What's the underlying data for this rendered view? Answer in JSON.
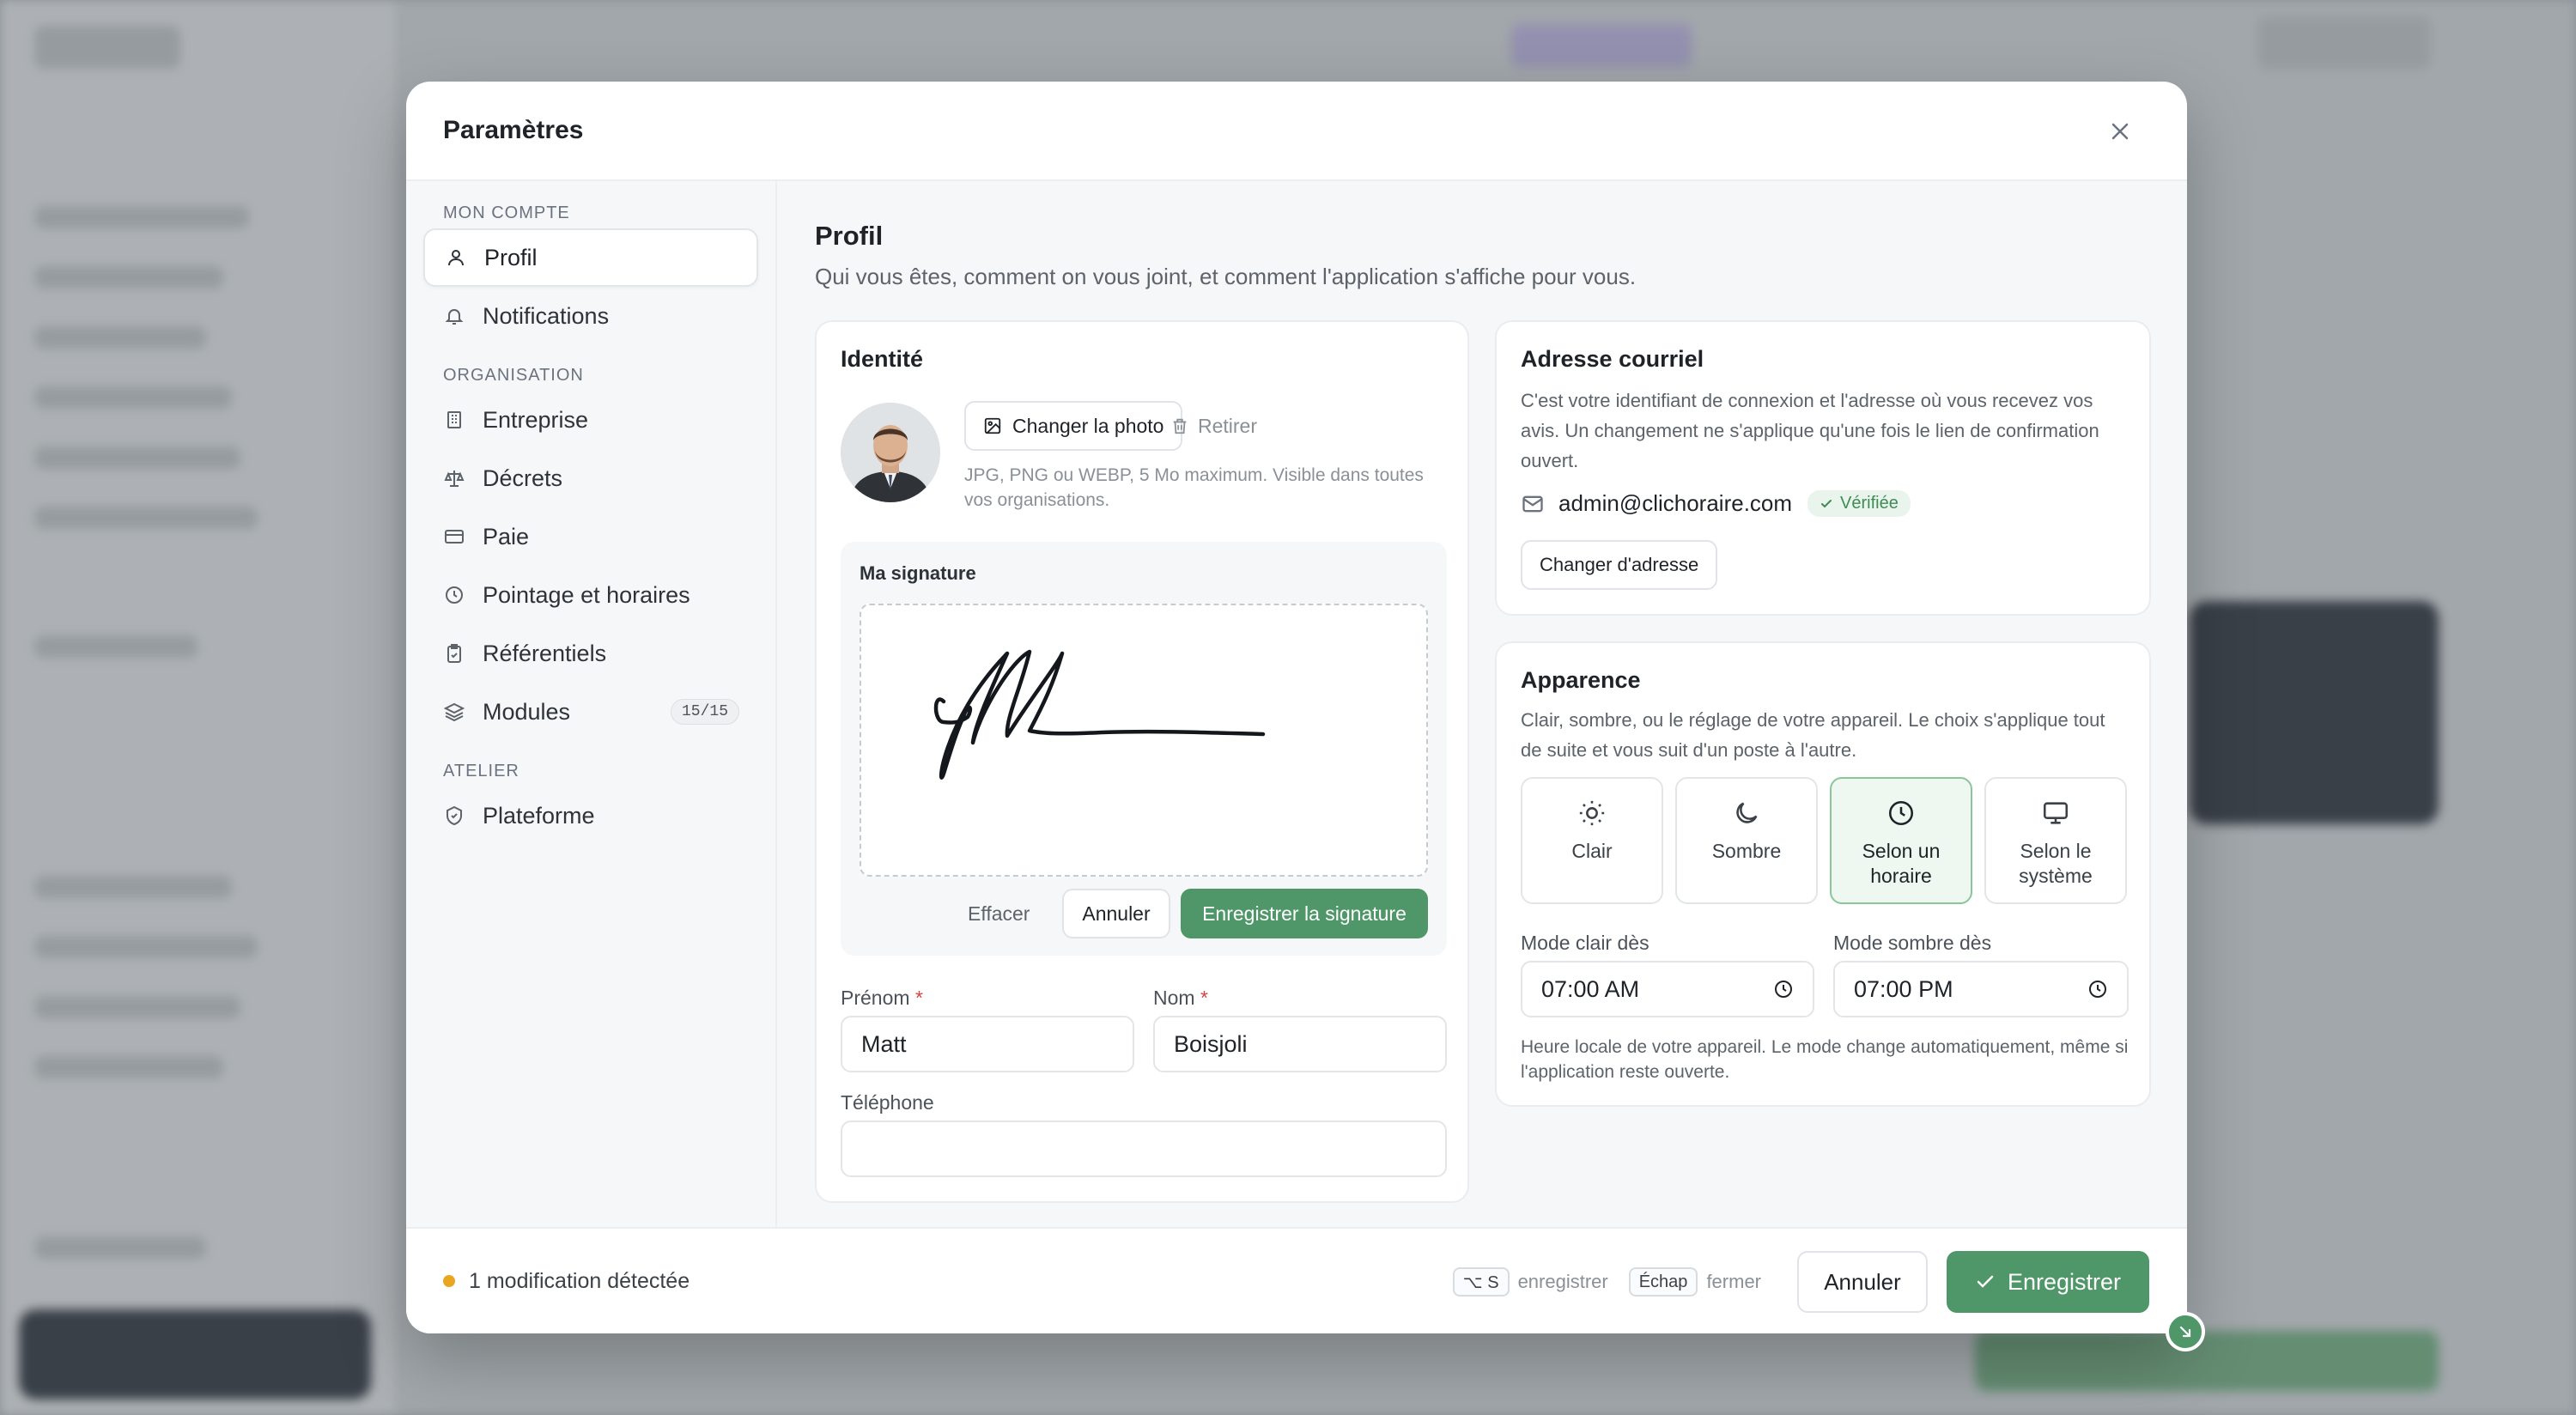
{
  "modal": {
    "title": "Paramètres"
  },
  "nav": {
    "sections": {
      "account": "MON COMPTE",
      "organization": "ORGANISATION",
      "workshop": "ATELIER"
    },
    "items": {
      "profile": "Profil",
      "notifications": "Notifications",
      "company": "Entreprise",
      "decrees": "Décrets",
      "payroll": "Paie",
      "timekeeping": "Pointage et horaires",
      "references": "Référentiels",
      "modules": "Modules",
      "modules_badge": "15/15",
      "platform": "Plateforme"
    }
  },
  "content": {
    "title": "Profil",
    "subtitle": "Qui vous êtes, comment on vous joint, et comment l'application s'affiche pour vous."
  },
  "identity": {
    "title": "Identité",
    "change_photo": "Changer la photo",
    "remove": "Retirer",
    "photo_hint": "JPG, PNG ou WEBP, 5 Mo maximum. Visible dans toutes vos organisations.",
    "signature_label": "Ma signature",
    "clear": "Effacer",
    "cancel": "Annuler",
    "save_signature": "Enregistrer la signature",
    "first_name_label": "Prénom",
    "first_name": "Matt",
    "last_name_label": "Nom",
    "last_name": "Boisjoli",
    "phone_label": "Téléphone",
    "phone": "",
    "required_mark": "*"
  },
  "email": {
    "title": "Adresse courriel",
    "description": "C'est votre identifiant de connexion et l'adresse où vous recevez vos avis. Un changement ne s'applique qu'une fois le lien de confirmation ouvert.",
    "address": "admin@clichoraire.com",
    "verified": "Vérifiée",
    "change": "Changer d'adresse"
  },
  "appearance": {
    "title": "Apparence",
    "description": "Clair, sombre, ou le réglage de votre appareil. Le choix s'applique tout de suite et vous suit d'un poste à l'autre.",
    "options": {
      "light": "Clair",
      "dark": "Sombre",
      "schedule": "Selon un horaire",
      "system": "Selon le système"
    },
    "selected": "schedule",
    "light_from_label": "Mode clair dès",
    "light_from": "07:00 AM",
    "dark_from_label": "Mode sombre dès",
    "dark_from": "07:00 PM",
    "schedule_hint": "Heure locale de votre appareil. Le mode change automatiquement, même si l'application reste ouverte."
  },
  "footer": {
    "changes": "1 modification détectée",
    "shortcut_save_key": "⌥ S",
    "shortcut_save_label": "enregistrer",
    "shortcut_close_key": "Échap",
    "shortcut_close_label": "fermer",
    "cancel": "Annuler",
    "save": "Enregistrer"
  },
  "colors": {
    "accent": "#4f9668",
    "warning_dot": "#e9a620",
    "verified": "#3f8b57"
  }
}
